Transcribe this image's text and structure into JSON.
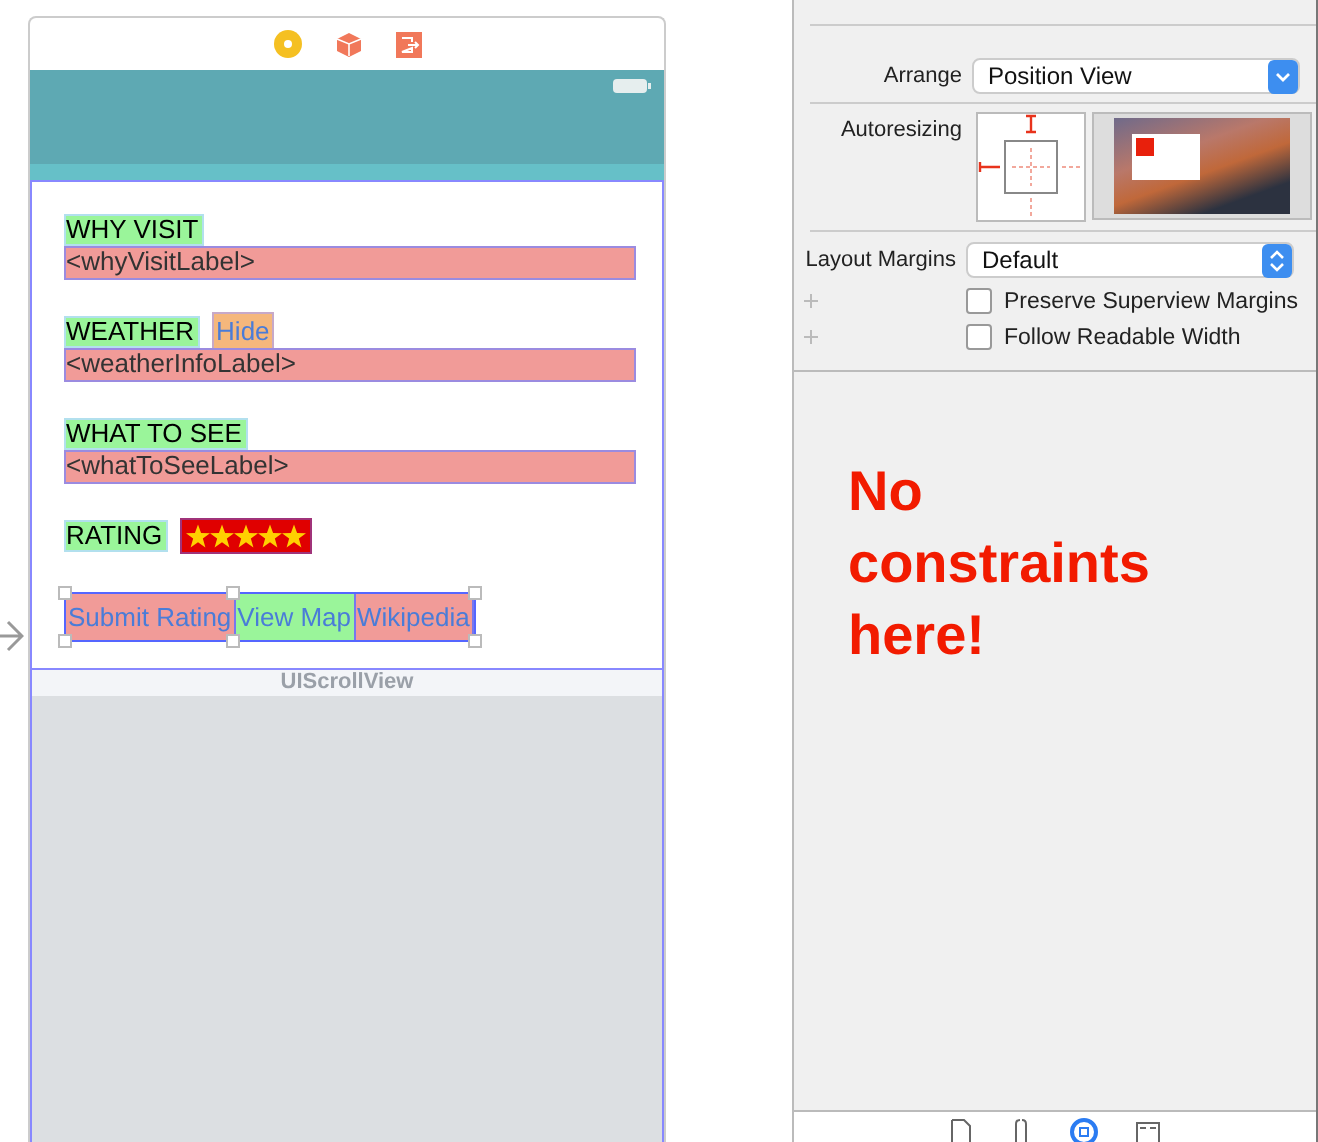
{
  "labels": [
    {
      "kind": "plain",
      "title": "WHY VISIT",
      "value": "<whyVisitLabel>"
    },
    {
      "kind": "with-button",
      "title": "WEATHER",
      "button": "Hide",
      "value": "<weatherInfoLabel>"
    },
    {
      "kind": "plain",
      "title": "WHAT TO SEE",
      "value": "<whatToSeeLabel>"
    }
  ],
  "rating": {
    "title": "RATING",
    "stars": 5
  },
  "buttons": [
    {
      "label": "Submit Rating",
      "color": "#f19b98"
    },
    {
      "label": "View Map",
      "color": "#9af59a"
    },
    {
      "label": "Wikipedia",
      "color": "#f19b98"
    }
  ],
  "scroll_view_label": "UIScrollView",
  "inspector": {
    "arrange_label": "Arrange",
    "arrange_value": "Position View",
    "autoresizing_label": "Autoresizing",
    "layout_margins_label": "Layout Margins",
    "layout_margins_value": "Default",
    "options": [
      {
        "label": "Preserve Superview Margins",
        "checked": false
      },
      {
        "label": "Follow Readable Width",
        "checked": false
      }
    ]
  },
  "note": "No constraints here!"
}
